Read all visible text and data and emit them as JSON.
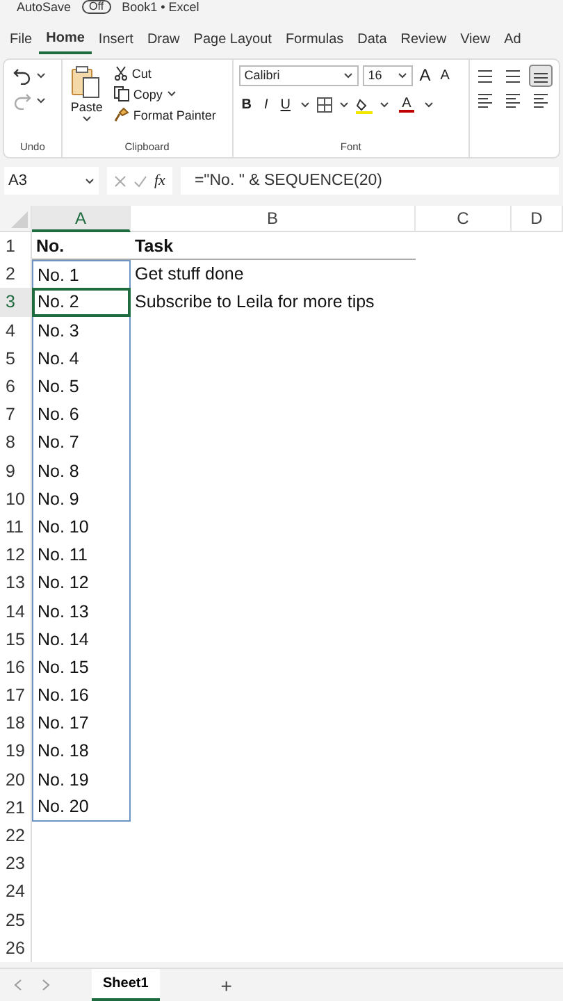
{
  "title_bar": {
    "autosave": "AutoSave",
    "toggle": "Off",
    "toggle_on": false,
    "title": "Book1 • Excel"
  },
  "tabs": [
    {
      "label": "File",
      "selected": false
    },
    {
      "label": "Home",
      "selected": true
    },
    {
      "label": "Insert",
      "selected": false
    },
    {
      "label": "Draw",
      "selected": false
    },
    {
      "label": "Page Layout",
      "selected": false
    },
    {
      "label": "Formulas",
      "selected": false
    },
    {
      "label": "Data",
      "selected": false
    },
    {
      "label": "Review",
      "selected": false
    },
    {
      "label": "View",
      "selected": false
    },
    {
      "label": "Ad",
      "selected": false
    }
  ],
  "ribbon": {
    "undo_label": "Undo",
    "paste": "Paste",
    "cut": "Cut",
    "copy": "Copy",
    "format_painter": "Format Painter",
    "clipboard_label": "Clipboard",
    "font_name": "Calibri",
    "font_size": "16",
    "bold": "B",
    "italic": "I",
    "underline": "U",
    "font_color_letter": "A",
    "grow": "A",
    "shrink": "A",
    "font_label": "Font"
  },
  "formula_bar": {
    "name_box": "A3",
    "fx": "fx",
    "formula": "=\"No. \" & SEQUENCE(20)"
  },
  "columns": [
    {
      "label": "A",
      "selected": true
    },
    {
      "label": "B",
      "selected": false
    },
    {
      "label": "C",
      "selected": false
    },
    {
      "label": "D",
      "selected": false
    }
  ],
  "rows": [
    {
      "number": "1",
      "a": "No.",
      "b": "Task",
      "bold": true,
      "selected": false,
      "in_spill": false
    },
    {
      "number": "2",
      "a": "No. 1",
      "b": "Get stuff done",
      "bold": false,
      "selected": false,
      "in_spill": true
    },
    {
      "number": "3",
      "a": "No. 2",
      "b": "Subscribe to Leila for more tips",
      "bold": false,
      "selected": true,
      "in_spill": true
    },
    {
      "number": "4",
      "a": "No. 3",
      "bold": false,
      "selected": false,
      "in_spill": true
    },
    {
      "number": "5",
      "a": "No. 4",
      "bold": false,
      "selected": false,
      "in_spill": true
    },
    {
      "number": "6",
      "a": "No. 5",
      "bold": false,
      "selected": false,
      "in_spill": true
    },
    {
      "number": "7",
      "a": "No. 6",
      "bold": false,
      "selected": false,
      "in_spill": true
    },
    {
      "number": "8",
      "a": "No. 7",
      "bold": false,
      "selected": false,
      "in_spill": true
    },
    {
      "number": "9",
      "a": "No. 8",
      "bold": false,
      "selected": false,
      "in_spill": true
    },
    {
      "number": "10",
      "a": "No. 9",
      "bold": false,
      "selected": false,
      "in_spill": true
    },
    {
      "number": "11",
      "a": "No. 10",
      "bold": false,
      "selected": false,
      "in_spill": true
    },
    {
      "number": "12",
      "a": "No. 11",
      "bold": false,
      "selected": false,
      "in_spill": true
    },
    {
      "number": "13",
      "a": "No. 12",
      "bold": false,
      "selected": false,
      "in_spill": true
    },
    {
      "number": "14",
      "a": "No. 13",
      "bold": false,
      "selected": false,
      "in_spill": true
    },
    {
      "number": "15",
      "a": "No. 14",
      "bold": false,
      "selected": false,
      "in_spill": true
    },
    {
      "number": "16",
      "a": "No. 15",
      "bold": false,
      "selected": false,
      "in_spill": true
    },
    {
      "number": "17",
      "a": "No. 16",
      "bold": false,
      "selected": false,
      "in_spill": true
    },
    {
      "number": "18",
      "a": "No. 17",
      "bold": false,
      "selected": false,
      "in_spill": true
    },
    {
      "number": "19",
      "a": "No. 18",
      "bold": false,
      "selected": false,
      "in_spill": true
    },
    {
      "number": "20",
      "a": "No. 19",
      "bold": false,
      "selected": false,
      "in_spill": true
    },
    {
      "number": "21",
      "a": "No. 20",
      "bold": false,
      "selected": false,
      "in_spill": true
    },
    {
      "number": "22",
      "selected": false
    },
    {
      "number": "23",
      "selected": false
    },
    {
      "number": "24",
      "selected": false
    },
    {
      "number": "25",
      "selected": false
    },
    {
      "number": "26",
      "selected": false
    }
  ],
  "sheet_tabs": [
    {
      "label": "Sheet1",
      "selected": true
    }
  ],
  "add_sheet": "+"
}
